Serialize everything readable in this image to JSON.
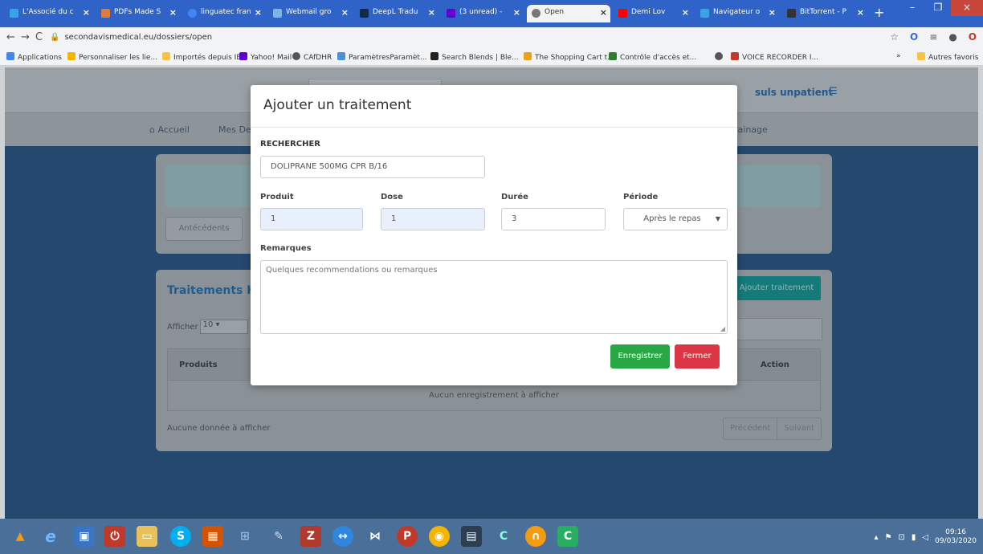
{
  "browser": {
    "tabs": [
      {
        "label": "L'Associé du c",
        "color": "#3aa3e3",
        "active": false
      },
      {
        "label": "PDFs Made S",
        "color": "#e07b39",
        "active": false
      },
      {
        "label": "linguatec fran",
        "color": "#4285f4",
        "active": false
      },
      {
        "label": "Webmail gro",
        "color": "#7fb2e5",
        "active": false
      },
      {
        "label": "DeepL Tradu",
        "color": "#0f2b46",
        "active": false
      },
      {
        "label": "(3 unread) -",
        "color": "#6001d2",
        "active": false
      },
      {
        "label": "Open",
        "color": "#777777",
        "active": true
      },
      {
        "label": "Demi Lov",
        "color": "#ff0000",
        "active": false
      },
      {
        "label": "Navigateur o",
        "color": "#3aa3e3",
        "active": false
      },
      {
        "label": "BitTorrent - P",
        "color": "#333333",
        "active": false
      }
    ],
    "new_tab": "+",
    "url": "secondavismedical.eu/dossiers/open",
    "bookmarks": [
      {
        "label": "Applications",
        "color": "#4285f4"
      },
      {
        "label": "Personnaliser les lie...",
        "color": "#f4b400"
      },
      {
        "label": "Importés depuis IE",
        "color": "#f6c343"
      },
      {
        "label": "Yahoo! Mail",
        "color": "#6001d2"
      },
      {
        "label": "CAfDHR",
        "color": "#555555"
      },
      {
        "label": "ParamètresParamèt...",
        "color": "#4a90d9"
      },
      {
        "label": "Search Blends | Ble...",
        "color": "#222222"
      },
      {
        "label": "The Shopping Cart t...",
        "color": "#e8a317"
      },
      {
        "label": "Contrôle d'accès et...",
        "color": "#2e7d32"
      },
      {
        "label": "",
        "color": "#555555"
      },
      {
        "label": "VOICE RECORDER I...",
        "color": "#c0392b"
      }
    ],
    "other_bookmarks": "Autres favoris",
    "more_bookmarks": "»"
  },
  "page": {
    "user": "suls unpatient",
    "nav": [
      "Accueil",
      "Mes De",
      "rainage"
    ],
    "tab_button": "Antécédents",
    "section_title": "Traitements H",
    "add_button": "Ajouter traitement",
    "show_label": "Afficher",
    "show_value": "10",
    "columns": [
      "Produits",
      "Action"
    ],
    "empty_message": "Aucun enregistrement à afficher",
    "no_data": "Aucune donnée à afficher",
    "prev": "Précédent",
    "next": "Suivant"
  },
  "modal": {
    "title": "Ajouter un traitement",
    "search_label": "RECHERCHER",
    "search_value": "DOLIPRANE 500MG CPR B/16",
    "product_label": "Produit",
    "product_value": "1",
    "dose_label": "Dose",
    "dose_value": "1",
    "duration_label": "Durée",
    "duration_value": "3",
    "period_label": "Période",
    "period_value": "Après le repas",
    "remarks_label": "Remarques",
    "remarks_placeholder": "Quelques recommendations ou remarques",
    "save": "Enregistrer",
    "close": "Fermer"
  },
  "taskbar": {
    "time": "09:16",
    "date": "09/03/2020"
  }
}
